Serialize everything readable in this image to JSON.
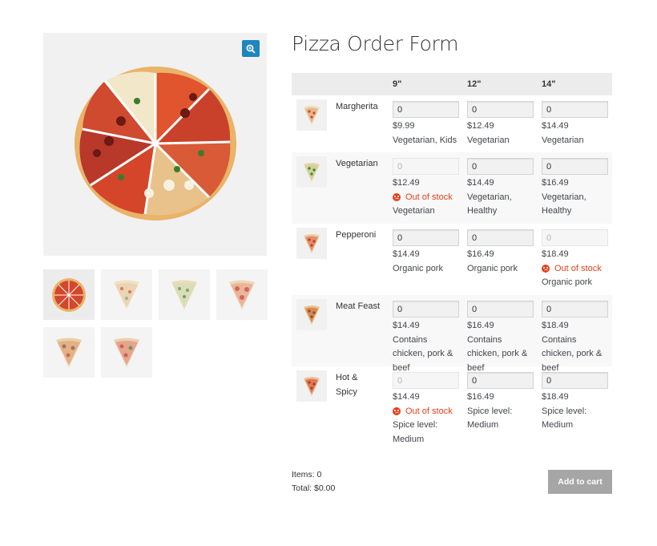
{
  "form": {
    "title": "Pizza Order Form",
    "headers": [
      "9\"",
      "12\"",
      "14\""
    ],
    "rows": [
      {
        "name": "Margherita",
        "icon": "pizza-slice-margherita",
        "cells": [
          {
            "value": "0",
            "price": "$9.99",
            "tags": "Vegetarian, Kids",
            "out_of_stock": false
          },
          {
            "value": "0",
            "price": "$12.49",
            "tags": "Vegetarian",
            "out_of_stock": false
          },
          {
            "value": "0",
            "price": "$14.49",
            "tags": "Vegetarian",
            "out_of_stock": false
          }
        ]
      },
      {
        "name": "Vegetarian",
        "icon": "pizza-slice-vegetarian",
        "cells": [
          {
            "value": "0",
            "price": "$12.49",
            "tags": "Vegetarian",
            "out_of_stock": true,
            "status": "Out of stock"
          },
          {
            "value": "0",
            "price": "$14.49",
            "tags": "Vegetarian, Healthy",
            "out_of_stock": false
          },
          {
            "value": "0",
            "price": "$16.49",
            "tags": "Vegetarian, Healthy",
            "out_of_stock": false
          }
        ]
      },
      {
        "name": "Pepperoni",
        "icon": "pizza-slice-pepperoni",
        "cells": [
          {
            "value": "0",
            "price": "$14.49",
            "tags": "Organic pork",
            "out_of_stock": false
          },
          {
            "value": "0",
            "price": "$16.49",
            "tags": "Organic pork",
            "out_of_stock": false
          },
          {
            "value": "0",
            "price": "$18.49",
            "tags": "Organic pork",
            "out_of_stock": true,
            "status": "Out of stock"
          }
        ]
      },
      {
        "name": "Meat Feast",
        "icon": "pizza-slice-meat-feast",
        "cells": [
          {
            "value": "0",
            "price": "$14.49",
            "tags": "Contains chicken, pork & beef",
            "out_of_stock": false
          },
          {
            "value": "0",
            "price": "$16.49",
            "tags": "Contains chicken, pork & beef",
            "out_of_stock": false
          },
          {
            "value": "0",
            "price": "$18.49",
            "tags": "Contains chicken, pork & beef",
            "out_of_stock": false
          }
        ]
      },
      {
        "name": "Hot & Spicy",
        "icon": "pizza-slice-hot-spicy",
        "cells": [
          {
            "value": "0",
            "price": "$14.49",
            "tags": "Spice level: Medium",
            "out_of_stock": true,
            "status": "Out of stock"
          },
          {
            "value": "0",
            "price": "$16.49",
            "tags": "Spice level: Medium",
            "out_of_stock": false
          },
          {
            "value": "0",
            "price": "$18.49",
            "tags": "Spice level: Medium",
            "out_of_stock": false
          }
        ]
      }
    ]
  },
  "totals": {
    "items_label": "Items: 0",
    "total_label": "Total: $0.00"
  },
  "cart": {
    "add_label": "Add to cart"
  },
  "gallery": {
    "zoom_icon": "magnify-plus-icon",
    "thumbnails": [
      "whole-pizza",
      "margherita-slice",
      "vegetarian-slice",
      "pepperoni-slice",
      "meat-feast-slice",
      "hot-spicy-slice"
    ]
  },
  "colors": {
    "zoom_button": "#1e85be",
    "out_of_stock": "#e2401c",
    "add_to_cart_button": "#a6a6a6",
    "table_header": "#ececec"
  }
}
